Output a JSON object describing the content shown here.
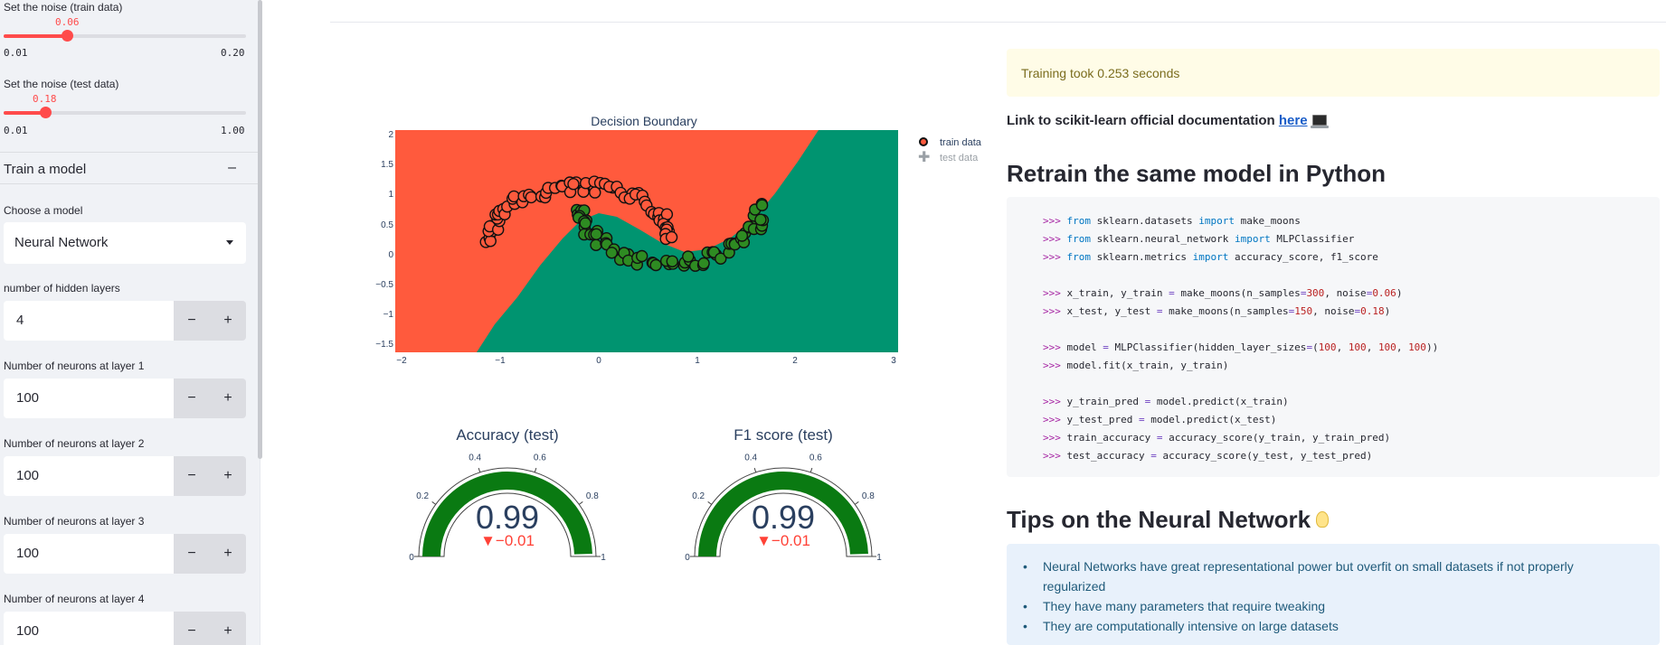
{
  "sidebar": {
    "noise_train": {
      "label": "Set the noise (train data)",
      "value": "0.06",
      "min": "0.01",
      "max": "0.20",
      "fraction": 0.263
    },
    "noise_test": {
      "label": "Set the noise (test data)",
      "value": "0.18",
      "min": "0.01",
      "max": "1.00",
      "fraction": 0.172
    },
    "train_section": {
      "title": "Train a model",
      "toggle": "–"
    },
    "model_select": {
      "label": "Choose a model",
      "value": "Neural Network"
    },
    "hidden_layers": {
      "label": "number of hidden layers",
      "value": "4",
      "minus": "−",
      "plus": "+"
    },
    "neurons": [
      {
        "label": "Number of neurons at layer 1",
        "value": "100",
        "minus": "−",
        "plus": "+"
      },
      {
        "label": "Number of neurons at layer 2",
        "value": "100",
        "minus": "−",
        "plus": "+"
      },
      {
        "label": "Number of neurons at layer 3",
        "value": "100",
        "minus": "−",
        "plus": "+"
      },
      {
        "label": "Number of neurons at layer 4",
        "value": "100",
        "minus": "−",
        "plus": "+"
      }
    ]
  },
  "plot": {
    "title": "Decision Boundary",
    "x_ticks": [
      "−2",
      "−1",
      "0",
      "1",
      "2",
      "3"
    ],
    "y_ticks": [
      "2",
      "1.5",
      "1",
      "0.5",
      "0",
      "−0.5",
      "−1",
      "−1.5"
    ],
    "legend": {
      "train": "train data",
      "test": "test data"
    },
    "colors": {
      "class0": "#ff5a3d",
      "class1": "#009470",
      "point_train": "#ff5a3d",
      "point_test": "#2e8b22"
    }
  },
  "chart_data": {
    "type": "scatter",
    "title": "Decision Boundary",
    "xlabel": "",
    "ylabel": "",
    "xlim": [
      -2,
      3
    ],
    "ylim": [
      -1.6,
      2.1
    ],
    "series": [
      {
        "name": "train data"
      },
      {
        "name": "test data"
      }
    ]
  },
  "gauges": [
    {
      "title": "Accuracy (test)",
      "value": "0.99",
      "delta": "▼−0.01",
      "value_num": 0.99,
      "ticks": [
        "0",
        "0.2",
        "0.4",
        "0.6",
        "0.8",
        "1"
      ]
    },
    {
      "title": "F1 score (test)",
      "value": "0.99",
      "delta": "▼−0.01",
      "value_num": 0.99,
      "ticks": [
        "0",
        "0.2",
        "0.4",
        "0.6",
        "0.8",
        "1"
      ]
    }
  ],
  "main": {
    "training_time": "Training took 0.253 seconds",
    "link_prefix": "Link to scikit-learn official documentation ",
    "link_text": "here",
    "retrain_heading": "Retrain the same model in Python",
    "code_lines": [
      ">>> from sklearn.datasets import make_moons",
      ">>> from sklearn.neural_network import MLPClassifier",
      ">>> from sklearn.metrics import accuracy_score, f1_score",
      "",
      ">>> x_train, y_train = make_moons(n_samples=300, noise=0.06)",
      ">>> x_test, y_test = make_moons(n_samples=150, noise=0.18)",
      "",
      ">>> model = MLPClassifier(hidden_layer_sizes=(100, 100, 100, 100))",
      ">>> model.fit(x_train, y_train)",
      "",
      ">>> y_train_pred = model.predict(x_train)",
      ">>> y_test_pred = model.predict(x_test)",
      ">>> train_accuracy = accuracy_score(y_train, y_train_pred)",
      ">>> test_accuracy = accuracy_score(y_test, y_test_pred)"
    ],
    "tips_heading": "Tips on the Neural Network",
    "tips": [
      "Neural Networks have great representational power but overfit on small datasets if not properly regularized",
      "They have many parameters that require tweaking",
      "They are computationally intensive on large datasets"
    ]
  }
}
